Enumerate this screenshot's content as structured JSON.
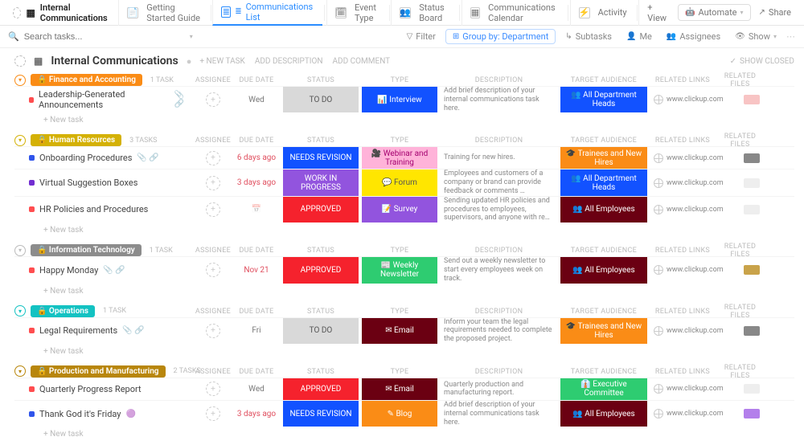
{
  "header": {
    "title": "Internal Communications",
    "tabs": [
      {
        "label": "Getting Started Guide",
        "icon": "📄"
      },
      {
        "label": "Communications List",
        "icon": "≣",
        "active": true
      },
      {
        "label": "Event Type",
        "icon": "🗓"
      },
      {
        "label": "Status Board",
        "icon": "👥"
      },
      {
        "label": "Communications Calendar",
        "icon": "▦"
      },
      {
        "label": "Activity",
        "icon": "⚡"
      }
    ],
    "add_view": "+ View",
    "automate": "Automate",
    "share": "Share"
  },
  "filterbar": {
    "search_placeholder": "Search tasks...",
    "filter": "Filter",
    "group_by": "Group by: Department",
    "subtasks": "Subtasks",
    "me": "Me",
    "assignees": "Assignees",
    "show": "Show"
  },
  "page": {
    "title": "Internal Communications",
    "new_task": "+ NEW TASK",
    "add_desc": "ADD DESCRIPTION",
    "add_comment": "ADD COMMENT",
    "show_closed": "SHOW CLOSED"
  },
  "columns": {
    "assignee": "ASSIGNEE",
    "due": "DUE DATE",
    "status": "STATUS",
    "type": "TYPE",
    "description": "DESCRIPTION",
    "target": "TARGET AUDIENCE",
    "related": "RELATED LINKS",
    "files": "RELATED FILES"
  },
  "new_task_label": "+ New task",
  "groups": [
    {
      "name": "Finance and Accounting",
      "count": "1 TASK",
      "color": "#fa8c16",
      "caret": "#fa8c16",
      "tasks": [
        {
          "sq": "#ff4d4f",
          "name": "Leadership-Generated Announcements",
          "icons": "📎 🔗",
          "due": "Wed",
          "overdue": false,
          "status": {
            "t": "TO DO",
            "b": "#d9d9d9",
            "c": "#555"
          },
          "type": {
            "t": "📊  Interview",
            "b": "#1252ff"
          },
          "desc": "Add brief description of your internal communications task here.",
          "target": {
            "t": "👥 All Department Heads",
            "b": "#1252ff"
          },
          "rel": "www.clickup.com",
          "file": "#f8c4c4"
        }
      ]
    },
    {
      "name": "Human Resources",
      "count": "3 TASKS",
      "color": "#d4b106",
      "caret": "#d4b106",
      "tasks": [
        {
          "sq": "#2f54eb",
          "name": "Onboarding Procedures",
          "icons": "📎 🔗",
          "due": "6 days ago",
          "overdue": true,
          "status": {
            "t": "NEEDS REVISION",
            "b": "#1252ff"
          },
          "type": {
            "t": "🎥 Webinar and Training",
            "b": "#ffb3d9",
            "c": "#a3006f"
          },
          "desc": "Training for new hires.",
          "target": {
            "t": "🎓 Trainees and New Hires",
            "b": "#fa8c16"
          },
          "rel": "www.clickup.com",
          "file": "#888"
        },
        {
          "sq": "#722ed1",
          "name": "Virtual Suggestion Boxes",
          "icons": "",
          "due": "3 days ago",
          "overdue": true,
          "status": {
            "t": "WORK IN PROGRESS",
            "b": "#9254de"
          },
          "type": {
            "t": "💬  Forum",
            "b": "#ffe600",
            "c": "#555"
          },
          "desc": "Employees and customers of a company or brand can provide feedback or comments …",
          "target": {
            "t": "👥 All Department Heads",
            "b": "#1252ff"
          },
          "rel": "www.clickup.com",
          "file": "#eee"
        },
        {
          "sq": "#ff4d4f",
          "name": "HR Policies and Procedures",
          "icons": "",
          "due": "",
          "overdue": false,
          "status": {
            "t": "APPROVED",
            "b": "#f5222d"
          },
          "type": {
            "t": "📝  Survey",
            "b": "#9254de"
          },
          "desc": "Sending updated HR policies and procedures to employees, supervisors, and anyone with re…",
          "target": {
            "t": "👥  All Employees",
            "b": "#6b0012"
          },
          "rel": "www.clickup.com",
          "file": "#eee"
        }
      ]
    },
    {
      "name": "Information Technology",
      "count": "1 TASK",
      "color": "#8c8c8c",
      "caret": "#bbb",
      "tasks": [
        {
          "sq": "#ff4d4f",
          "name": "Happy Monday",
          "icons": "📎 🔗",
          "due": "Nov 21",
          "overdue": true,
          "status": {
            "t": "APPROVED",
            "b": "#f5222d"
          },
          "type": {
            "t": "📰 Weekly Newsletter",
            "b": "#2ecc71"
          },
          "desc": "Send out a weekly newsletter to start every employees week on track.",
          "target": {
            "t": "👥  All Employees",
            "b": "#6b0012"
          },
          "rel": "www.clickup.com",
          "file": "#c9a34a"
        }
      ]
    },
    {
      "name": "Operations",
      "count": "1 TASK",
      "color": "#13c2c2",
      "caret": "#13c2c2",
      "tasks": [
        {
          "sq": "#ff4d4f",
          "name": "Legal Requirements",
          "icons": "📎 🔗",
          "due": "Fri",
          "overdue": false,
          "status": {
            "t": "TO DO",
            "b": "#d9d9d9",
            "c": "#555"
          },
          "type": {
            "t": "✉  Email",
            "b": "#6b0012"
          },
          "desc": "Inform your team the legal requirements needed to complete the proposed project.",
          "target": {
            "t": "🎓 Trainees and New Hires",
            "b": "#fa8c16"
          },
          "rel": "www.clickup.com",
          "file": "#888"
        }
      ]
    },
    {
      "name": "Production and Manufacturing",
      "count": "2 TASKS",
      "color": "#b8860b",
      "caret": "#b8860b",
      "tasks": [
        {
          "sq": "#ff4d4f",
          "name": "Quarterly Progress Report",
          "icons": "",
          "due": "Wed",
          "overdue": false,
          "status": {
            "t": "APPROVED",
            "b": "#f5222d"
          },
          "type": {
            "t": "✉  Email",
            "b": "#6b0012"
          },
          "desc": "Quarterly production and manufacturing report.",
          "target": {
            "t": "👔 Executive Committee",
            "b": "#2ecc71"
          },
          "rel": "www.clickup.com",
          "file": "#eee"
        },
        {
          "sq": "#2f54eb",
          "name": "Thank God it's Friday",
          "icons": "🟣",
          "due": "3 days ago",
          "overdue": true,
          "status": {
            "t": "NEEDS REVISION",
            "b": "#1252ff"
          },
          "type": {
            "t": "✎  Blog",
            "b": "#fa8c16"
          },
          "desc": "Add brief description of your internal communications task here.",
          "target": {
            "t": "👥  All Employees",
            "b": "#6b0012"
          },
          "rel": "www.clickup.com",
          "file": "#b37feb"
        }
      ]
    }
  ]
}
